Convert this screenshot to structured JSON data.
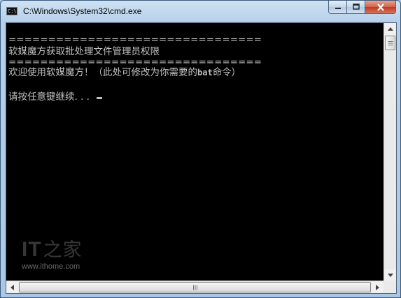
{
  "window": {
    "title": "C:\\Windows\\System32\\cmd.exe",
    "app_icon_text": "C:\\",
    "buttons": {
      "minimize": "minimize",
      "maximize": "maximize",
      "close": "close"
    }
  },
  "console": {
    "lines": [
      "================================",
      "软媒魔方获取批处理文件管理员权限",
      "================================",
      "欢迎使用软媒魔方！（此处可修改为你需要的",
      "bat",
      "命令）",
      "请按任意键继续. . . "
    ],
    "background": "#000000",
    "foreground": "#c0c0c0"
  },
  "watermark": {
    "logo_text": "IT",
    "logo_cn": "之家",
    "url": "www.ithome.com"
  }
}
